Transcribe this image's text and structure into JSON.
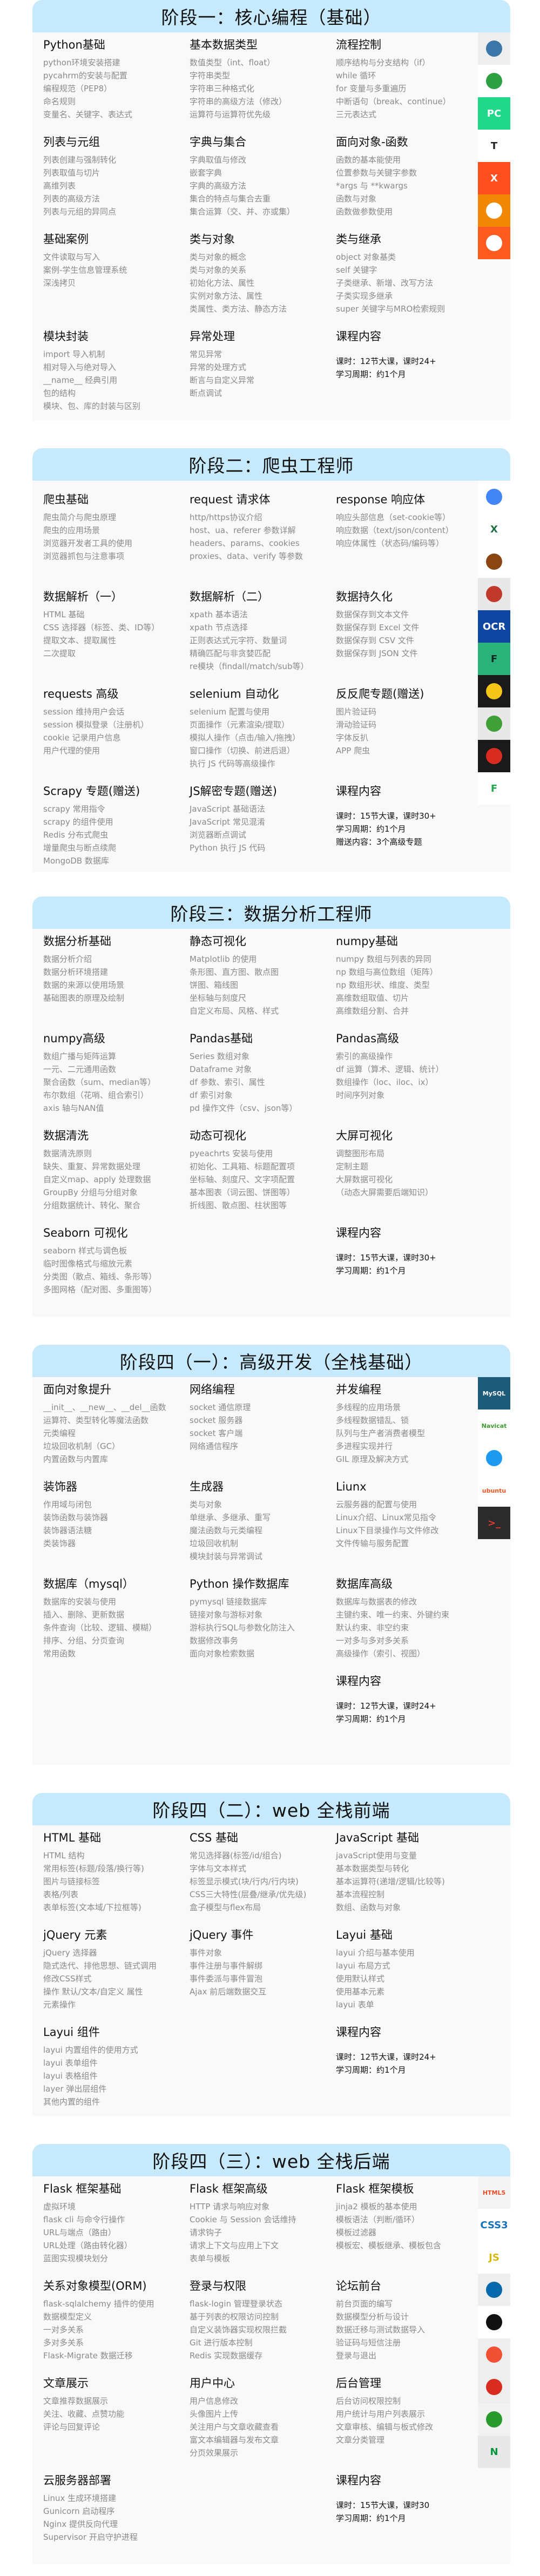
{
  "stages": [
    {
      "title": "阶段一：核心编程（基础）",
      "modules": [
        {
          "title": "Python基础",
          "items": [
            "python环境安装搭建",
            "pycahrm的安装与配置",
            "编程规范（PEP8）",
            "命名规则",
            "变量名、关键字、表达式"
          ]
        },
        {
          "title": "基本数据类型",
          "items": [
            "数值类型（int、float）",
            "字符串类型",
            "字符串三种格式化",
            "字符串的高级方法（修改）",
            "运算符与运算符优先级"
          ]
        },
        {
          "title": "流程控制",
          "items": [
            "顺序结构与分支结构（if）",
            "while 循环",
            "for 变量与多重遍历",
            "中断语句（break、continue）",
            "三元表达式"
          ]
        },
        {
          "title": "列表与元组",
          "items": [
            "列表创建与强制转化",
            "列表取值与切片",
            "高维列表",
            "列表的高级方法",
            "列表与元组的异同点"
          ]
        },
        {
          "title": "字典与集合",
          "items": [
            "字典取值与修改",
            "嵌套字典",
            "字典的高级方法",
            "集合的特点与集合去重",
            "集合运算（交、并、亦或集）"
          ]
        },
        {
          "title": "面向对象-函数",
          "items": [
            "函数的基本能使用",
            "位置参数与关键字参数",
            "*args 与 **kwargs",
            "函数与对象",
            "函数做参数使用"
          ]
        },
        {
          "title": "基础案例",
          "items": [
            "文件读取与写入",
            "案例-学生信息管理系统",
            "深浅拷贝"
          ]
        },
        {
          "title": "类与对象",
          "items": [
            "类与对象的概念",
            "类与对象的关系",
            "初始化方法、属性",
            "实例对象方法、属性",
            "类属性、类方法、静态方法"
          ]
        },
        {
          "title": "类与继承",
          "items": [
            "object 对象基类",
            "self 关键字",
            "子类继承、新增、改写方法",
            "子类实现多继承",
            "super 关键字与MRO检索规则"
          ]
        },
        {
          "title": "模块封装",
          "items": [
            "import 导入机制",
            "相对导入与绝对导入",
            "__name__ 经典引用",
            "包的结构",
            "模块、包、库的封装与区别"
          ]
        },
        {
          "title": "异常处理",
          "items": [
            "常见异常",
            "异常的处理方式",
            "断言与自定义异常",
            "断点调试"
          ]
        }
      ],
      "course": {
        "title": "课程内容",
        "lines": [
          "课时：12节大课，课时24+",
          "学习周期：约1个月"
        ]
      },
      "icons": [
        {
          "name": "python-icon",
          "bg": "#eeeeee",
          "fg": "#3b77a8",
          "label": ""
        },
        {
          "name": "jupyter-ring-icon",
          "bg": "#ffffff",
          "fg": "#2ea043",
          "label": ""
        },
        {
          "name": "pycharm-icon",
          "bg": "#21d789",
          "fg": "#ffffff",
          "label": "PC"
        },
        {
          "name": "typora-icon",
          "bg": "#ffffff",
          "fg": "#222222",
          "label": "T"
        },
        {
          "name": "xmind-icon",
          "bg": "#ff4f1f",
          "fg": "#ffffff",
          "label": "X"
        },
        {
          "name": "drawio-icon",
          "bg": "#f08705",
          "fg": "#ffffff",
          "label": ""
        },
        {
          "name": "player-icon",
          "bg": "#ff5a1f",
          "fg": "#ffffff",
          "label": ""
        }
      ]
    },
    {
      "title": "阶段二：爬虫工程师",
      "modules": [
        {
          "title": "爬虫基础",
          "items": [
            "爬虫简介与爬虫原理",
            "爬虫的应用场景",
            "浏览器开发者工具的使用",
            "浏览器抓包与注意事项"
          ]
        },
        {
          "title": "request 请求体",
          "items": [
            "http/https协议介绍",
            "host、ua、referer 参数详解",
            "headers、params、cookies",
            "proxies、data、verify 等参数"
          ]
        },
        {
          "title": "response 响应体",
          "items": [
            "响应头部信息（set-cookie等）",
            "响应数据（text/json/content）",
            "响应体属性（状态码/编码等）"
          ]
        },
        {
          "title": "数据解析（一）",
          "items": [
            "HTML 基础",
            "CSS 选择器（标签、类、ID等）",
            "提取文本、提取属性",
            "二次提取"
          ]
        },
        {
          "title": "数据解析（二）",
          "items": [
            "xpath 基本语法",
            "xpath 节点选择",
            "正则表达式元字符、数量词",
            "精确匹配与非贪婪匹配",
            "re模块（findall/match/sub等）"
          ]
        },
        {
          "title": "数据持久化",
          "items": [
            "数据保存到文本文件",
            "数据保存到 Excel 文件",
            "数据保存到 CSV 文件",
            "数据保存到 JSON 文件"
          ]
        },
        {
          "title": "requests 高级",
          "items": [
            "session 维持用户会话",
            "session 模拟登录（注册机）",
            "cookie 记录用户信息",
            "用户代理的使用"
          ]
        },
        {
          "title": "selenium 自动化",
          "items": [
            "selenium 配置与使用",
            "页面操作（元素渲染/提取）",
            "模拟人操作（点击/输入/拖拽）",
            "窗口操作（切换、前进后退）",
            "执行 JS 代码等高级操作"
          ]
        },
        {
          "title": "反反爬专题(赠送)",
          "items": [
            "图片验证码",
            "滑动验证码",
            "字体反扒",
            "APP 爬虫"
          ]
        },
        {
          "title": "Scrapy 专题(赠送)",
          "items": [
            "scrapy 常用指令",
            "scrapy 的组件使用",
            "Redis 分布式爬虫",
            "增量爬虫与断点续爬",
            "MongoDB 数据库"
          ]
        },
        {
          "title": "JS解密专题(赠送)",
          "items": [
            "JavaScript 基础语法",
            "JavaScript 常见混淆",
            "浏览器断点调试",
            "Python 执行 JS 代码"
          ]
        }
      ],
      "course": {
        "title": "课程内容",
        "lines": [
          "课时：15节大课，课时30+",
          "学习周期：约1个月",
          "赠送内容：3个高级专题"
        ]
      },
      "icons": [
        {
          "name": "chrome-icon",
          "bg": "#ffffff",
          "fg": "#4285f4",
          "label": ""
        },
        {
          "name": "excel-icon",
          "bg": "#ffffff",
          "fg": "#1d6f42",
          "label": "X"
        },
        {
          "name": "scraper-icon",
          "bg": "#ffffff",
          "fg": "#8b4513",
          "label": ""
        },
        {
          "name": "python-image-icon",
          "bg": "#e8e8e8",
          "fg": "#c0392b",
          "label": ""
        },
        {
          "name": "ocr-icon",
          "bg": "#0d47a1",
          "fg": "#ffffff",
          "label": "OCR"
        },
        {
          "name": "fiddler-icon",
          "bg": "#2bb17a",
          "fg": "#0b2a22",
          "label": "F"
        },
        {
          "name": "lightning-proxy-icon",
          "bg": "#1a1a1a",
          "fg": "#f5c518",
          "label": ""
        },
        {
          "name": "mongodb-icon",
          "bg": "#e8e8e8",
          "fg": "#3fa037",
          "label": ""
        },
        {
          "name": "redis-icon",
          "bg": "#1a1a1a",
          "fg": "#d82c20",
          "label": ""
        },
        {
          "name": "feapder-icon",
          "bg": "#ffffff",
          "fg": "#22a94b",
          "label": "F"
        }
      ]
    },
    {
      "title": "阶段三：数据分析工程师",
      "modules": [
        {
          "title": "数据分析基础",
          "items": [
            "数据分析介绍",
            "数据分析环境搭建",
            "数据的来源以使用场景",
            "基础图表的原理及绘制"
          ]
        },
        {
          "title": "静态可视化",
          "items": [
            "Matplotlib 的使用",
            "条形图、直方图、散点图",
            "饼图、箱线图",
            "坐标轴与刻度尺",
            "自定义布局、风格、样式"
          ]
        },
        {
          "title": "numpy基础",
          "items": [
            "numpy 数组与列表的异同",
            "np 数组与高位数组（矩阵）",
            "np 数组形状、维度、类型",
            "高维数组取值、切片",
            "高维数组分割、合并"
          ]
        },
        {
          "title": "numpy高级",
          "items": [
            "数组广播与矩阵运算",
            "一元、二元通用函数",
            "聚合函数（sum、median等）",
            "布尔数组（花哨、组合索引）",
            "axis 轴与NAN值"
          ]
        },
        {
          "title": "Pandas基础",
          "items": [
            "Series 数组对象",
            "Dataframe 对象",
            "df 参数、索引、属性",
            "df 索引对象",
            "pd 操作文件（csv、json等）"
          ]
        },
        {
          "title": "Pandas高级",
          "items": [
            "索引的高级操作",
            "df 运算（算术、逻辑、统计）",
            "数组操作（loc、iloc、ix）",
            "时间序列对象"
          ]
        },
        {
          "title": "数据清洗",
          "items": [
            "数据清洗原则",
            "缺失、重复、异常数据处理",
            "自定义map、apply 处理数据",
            "GroupBy 分组与分组对象",
            "分组数据统计、转化、聚合"
          ]
        },
        {
          "title": "动态可视化",
          "items": [
            "pyeachrts 安装与使用",
            "初始化、工具箱、标题配置项",
            "坐标轴、刻度尺、文字项配置",
            "基本图表（词云图、饼图等）",
            "折线图、散点图、柱状图等"
          ]
        },
        {
          "title": "大屏可视化",
          "items": [
            "调整图形布局",
            "定制主题",
            "大屏数据可视化",
            "（动态大屏需要后端知识）"
          ]
        },
        {
          "title": "Seaborn 可视化",
          "items": [
            "seaborn 样式与调色板",
            "临时图像格式与缩放元素",
            "分类图（散点、箱线、条形等）",
            "多图网格（配对图、多重图等）"
          ]
        }
      ],
      "course": {
        "title": "课程内容",
        "lines": [
          "课时：15节大课，课时30+",
          "学习周期：约1个月"
        ]
      },
      "icons": []
    },
    {
      "title": "阶段四（一）：高级开发（全栈基础）",
      "modules": [
        {
          "title": "面向对象提升",
          "items": [
            "__init__、__new__、__del__函数",
            "运算符、类型转化等魔法函数",
            "元类编程",
            "垃圾回收机制（GC）",
            "内置函数与内置库"
          ]
        },
        {
          "title": "网络编程",
          "items": [
            "socket 通信原理",
            "socket 服务器",
            "socket 客户端",
            "网络通信程序"
          ]
        },
        {
          "title": "并发编程",
          "items": [
            "多线程的应用场景",
            "多线程数据错乱、锁",
            "队列与生产者消费者模型",
            "多进程实现并行",
            "GIL 原理及解决方式"
          ]
        },
        {
          "title": "装饰器",
          "items": [
            "作用域与闭包",
            "装饰函数与装饰器",
            "装饰器语法糖",
            "类装饰器"
          ]
        },
        {
          "title": "生成器",
          "items": [
            "类与对象",
            "单继承、多继承、重写",
            "魔法函数与元类编程",
            "垃圾回收机制",
            "模块封装与异常调试"
          ]
        },
        {
          "title": "Liunx",
          "items": [
            "云服务器的配置与使用",
            "Linux介绍、Linux常见指令",
            "Linux下目录操作与文件修改",
            "文件传输与服务配置"
          ]
        },
        {
          "title": "数据库（mysql）",
          "items": [
            "数据库的安装与使用",
            "插入、删除、更新数据",
            "条件查询（比较、逻辑、模糊）",
            "排序、分组、分页查询",
            "常用函数"
          ]
        },
        {
          "title": "Python 操作数据库",
          "items": [
            "pymysql 链接数据库",
            "链接对象与游标对象",
            "游标执行SQL与参数化防注入",
            "数据修改事务",
            "面向对象检索数据"
          ]
        },
        {
          "title": "数据库高级",
          "items": [
            "数据库与数据表的修改",
            "主键约束、唯一约束、外键约束",
            "默认约束、非空约束",
            "一对多与多对多关系",
            "高级操作（索引、视图）"
          ]
        }
      ],
      "course": {
        "title": "课程内容",
        "lines": [
          "课时：12节大课，课时24+",
          "学习周期：约1个月"
        ]
      },
      "icons": [
        {
          "name": "mysql-icon",
          "bg": "#1d5b79",
          "fg": "#ffffff",
          "label": "MySQL"
        },
        {
          "name": "navicat-icon",
          "bg": "#ffffff",
          "fg": "#3c9a2e",
          "label": "Navicat"
        },
        {
          "name": "tencent-cloud-icon",
          "bg": "#ffffff",
          "fg": "#1e9bf0",
          "label": ""
        },
        {
          "name": "ubuntu-icon",
          "bg": "#ffffff",
          "fg": "#e95420",
          "label": "ubuntu"
        },
        {
          "name": "xshell-icon",
          "bg": "#2b2b2b",
          "fg": "#e53935",
          "label": ">_"
        }
      ]
    },
    {
      "title": "阶段四（二）：web 全栈前端",
      "modules": [
        {
          "title": "HTML 基础",
          "items": [
            "HTML 结构",
            "常用标签(标题/段落/换行等)",
            "图片与链接标签",
            "表格/列表",
            "表单标签(文本域/下拉框等)"
          ]
        },
        {
          "title": "CSS 基础",
          "items": [
            "常见选择器(标签/id/组合)",
            "字体与文本样式",
            "标签显示模式(块/行内/行内块)",
            "CSS三大特性(层叠/继承/优先级)",
            "盒子模型与flex布局"
          ]
        },
        {
          "title": "JavaScript 基础",
          "items": [
            "javaScript使用与变量",
            "基本数据类型与转化",
            "基本运算符(递增/逻辑/比较等)",
            "基本流程控制",
            "数组、函数与对象"
          ]
        },
        {
          "title": "jQuery 元素",
          "items": [
            "jQuery 选择器",
            "隐式迭代、排他思想、链式调用",
            "修改CSS样式",
            "操作 默认/文本/自定义 属性",
            "元素操作"
          ]
        },
        {
          "title": "jQuery 事件",
          "items": [
            "事件对象",
            "事件注册与事件解绑",
            "事件委派与事件冒泡",
            "Ajax 前后端数据交互"
          ]
        },
        {
          "title": "Layui 基础",
          "items": [
            "layui 介绍与基本使用",
            "layui 布局方式",
            "使用默认样式",
            "使用基本元素",
            "layui 表单"
          ]
        },
        {
          "title": "Layui 组件",
          "items": [
            "layui 内置组件的使用方式",
            "layui 表单组件",
            "layui 表格组件",
            "layer 弹出层组件",
            "其他内置的组件"
          ]
        }
      ],
      "course": {
        "title": "课程内容",
        "lines": [
          "课时：12节大课，课时24+",
          "学习周期：约1个月"
        ]
      },
      "icons": []
    },
    {
      "title": "阶段四（三）：web 全栈后端",
      "modules": [
        {
          "title": "Flask 框架基础",
          "items": [
            "虚拟环境",
            "flask cli 与命令行操作",
            "URL与端点（路由）",
            "URL处理（路由转化器）",
            "蓝图实现模块划分"
          ]
        },
        {
          "title": "Flask 框架高级",
          "items": [
            "HTTP 请求与响应对象",
            "Cookie 与 Session 会话维持",
            "请求钩子",
            "请求上下文与应用上下文",
            "表单与模板"
          ]
        },
        {
          "title": "Flask 框架模板",
          "items": [
            "jinja2 模板的基本使用",
            "模板语法（判断/循环）",
            "模板过滤器",
            "模板宏、模板继承、模板包含"
          ]
        },
        {
          "title": "关系对象模型(ORM)",
          "items": [
            "flask-sqlalchemy 插件的使用",
            "数据模型定义",
            "一对多关系",
            "多对多关系",
            "Flask-Migrate 数据迁移"
          ]
        },
        {
          "title": "登录与权限",
          "items": [
            "flask-login 管理登录状态",
            "基于列表的权限访问控制",
            "自定义装饰器实现权限拦截",
            "Git 进行版本控制",
            "Redis 实现数据缓存"
          ]
        },
        {
          "title": "论坛前台",
          "items": [
            "前台页面的编写",
            "数据模型分析与设计",
            "数据迁移与测试数据导入",
            "验证码与短信注册",
            "登录与退出"
          ]
        },
        {
          "title": "文章展示",
          "items": [
            "文章推荐数据展示",
            "关注、收藏、点赞功能",
            "评论与回复评论"
          ]
        },
        {
          "title": "用户中心",
          "items": [
            "用户信息修改",
            "头像图片上传",
            "关注用户与文章收藏查看",
            "富文本编辑器与发布文章",
            "分页效果展示"
          ]
        },
        {
          "title": "后台管理",
          "items": [
            "后台访问权限控制",
            "用户统计与用户列表展示",
            "文章审核、编辑与板式修改",
            "文章分类管理"
          ]
        },
        {
          "title": "云服务器部署",
          "items": [
            "Linux 生成环境搭建",
            "Gunicorn 启动程序",
            "Nginx 提供反向代理",
            "Supervisor 开启守护进程"
          ]
        }
      ],
      "course": {
        "title": "课程内容",
        "lines": [
          "课时：15节大课，课时30",
          "学习周期：约1个月"
        ]
      },
      "icons": [
        {
          "name": "html5-icon",
          "bg": "#f4f4f4",
          "fg": "#e44d26",
          "label": "HTML5"
        },
        {
          "name": "css3-icon",
          "bg": "#ffffff",
          "fg": "#1572b6",
          "label": "CSS3"
        },
        {
          "name": "javascript-icon",
          "bg": "#ffffff",
          "fg": "#d4b80a",
          "label": "JS"
        },
        {
          "name": "jquery-icon",
          "bg": "#eeeeee",
          "fg": "#0769ad",
          "label": ""
        },
        {
          "name": "flask-icon",
          "bg": "#ffffff",
          "fg": "#111111",
          "label": ""
        },
        {
          "name": "git-icon",
          "bg": "#eeeeee",
          "fg": "#f05033",
          "label": ""
        },
        {
          "name": "redis-icon",
          "bg": "#eeeeee",
          "fg": "#d82c20",
          "label": ""
        },
        {
          "name": "gunicorn-icon",
          "bg": "#f2f2f2",
          "fg": "#299a2c",
          "label": ""
        },
        {
          "name": "nginx-icon",
          "bg": "#e8e8e8",
          "fg": "#009639",
          "label": "N"
        }
      ]
    }
  ]
}
